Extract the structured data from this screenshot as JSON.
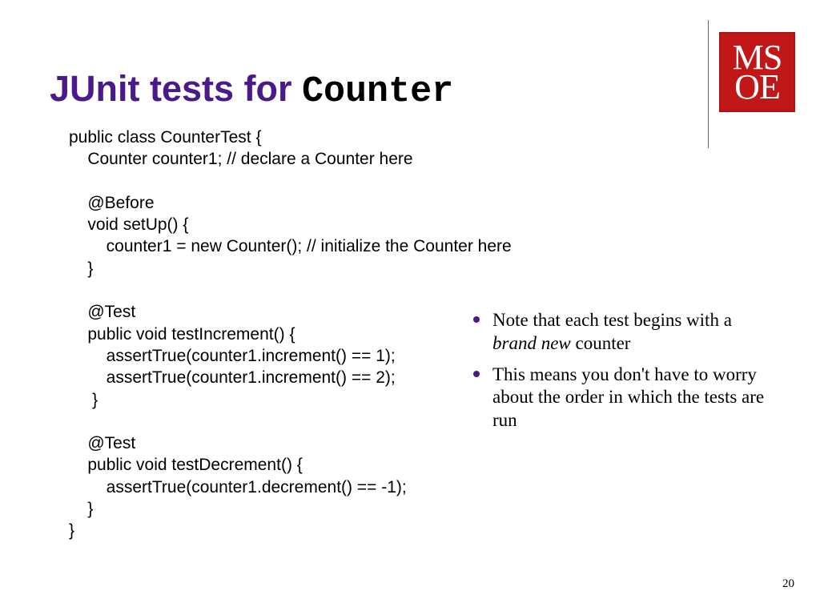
{
  "title": {
    "part1": "JUnit tests for ",
    "part2": "Counter"
  },
  "code": "public class CounterTest {\n    Counter counter1; // declare a Counter here\n\n    @Before\n    void setUp() {\n        counter1 = new Counter(); // initialize the Counter here\n    }\n\n    @Test\n    public void testIncrement() {\n        assertTrue(counter1.increment() == 1);\n        assertTrue(counter1.increment() == 2);\n     }\n\n    @Test\n    public void testDecrement() {\n        assertTrue(counter1.decrement() == -1);\n    }\n}",
  "notes": {
    "item1_a": "Note that each test begins with a ",
    "item1_b": "brand new",
    "item1_c": " counter",
    "item2": "This means you don't have to worry about the order in which the tests are run"
  },
  "logo": {
    "row1a": "M",
    "row1b": "S",
    "row2a": "O",
    "row2b": "E"
  },
  "pagenum": "20"
}
